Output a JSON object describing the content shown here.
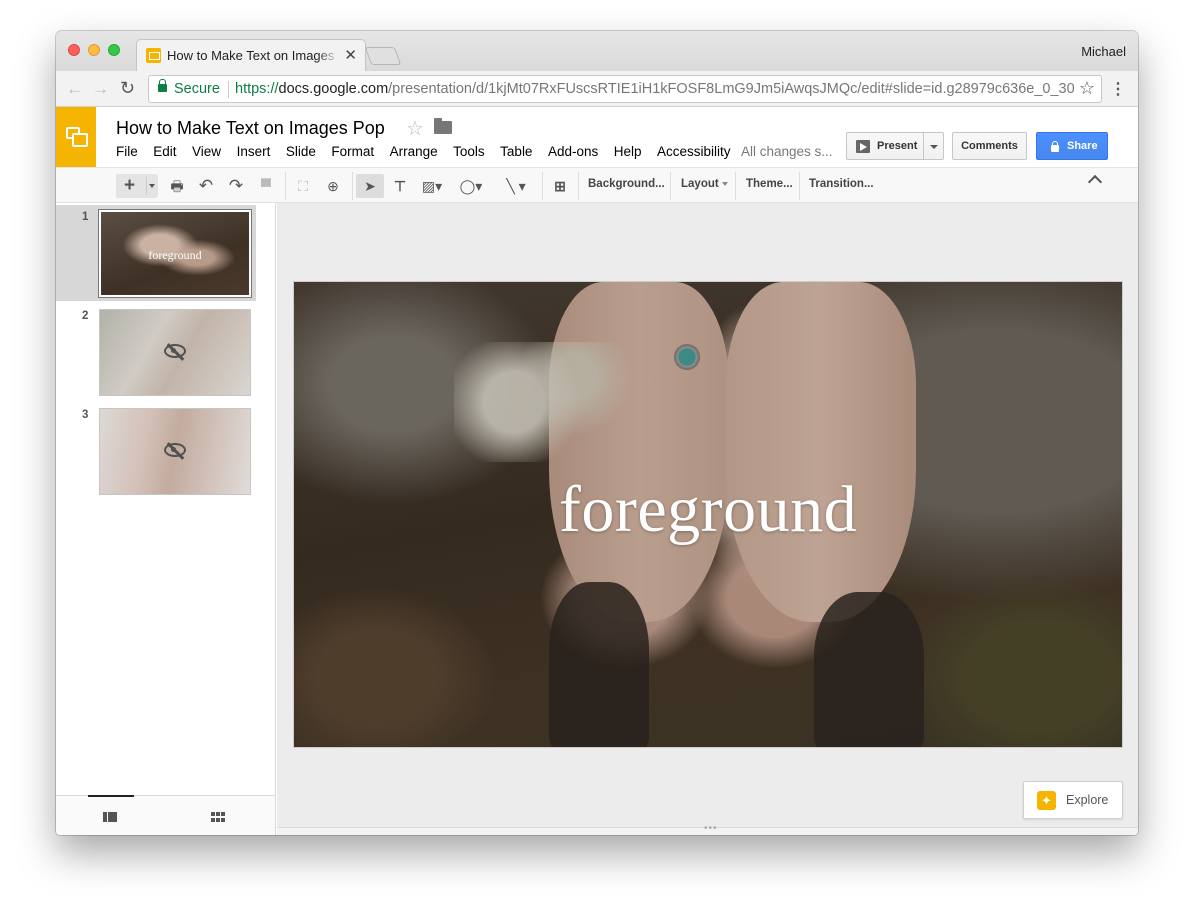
{
  "browser": {
    "tab_title": "How to Make Text on Images Pop",
    "tab_close": "✕",
    "user": "Michael",
    "secure_label": "Secure",
    "url_scheme": "https://",
    "url_host": "docs.google.com",
    "url_path": "/presentation/d/1kjMt07RxFUscsRTIE1iH1kFOSF8LmG9Jm5iAwqsJMQc/edit#slide=id.g28979c636e_0_30"
  },
  "docs": {
    "title": "How to Make Text on Images Pop",
    "menus": [
      "File",
      "Edit",
      "View",
      "Insert",
      "Slide",
      "Format",
      "Arrange",
      "Tools",
      "Table",
      "Add-ons",
      "Help",
      "Accessibility"
    ],
    "save_status": "All changes s...",
    "present_label": "Present",
    "comments_label": "Comments",
    "share_label": "Share"
  },
  "toolbar": {
    "background_label": "Background...",
    "layout_label": "Layout",
    "theme_label": "Theme...",
    "transition_label": "Transition..."
  },
  "filmstrip": {
    "slides": [
      {
        "number": "1",
        "thumb_text": "foreground",
        "hidden": false
      },
      {
        "number": "2",
        "thumb_text": "",
        "hidden": true
      },
      {
        "number": "3",
        "thumb_text": "",
        "hidden": true
      }
    ]
  },
  "slide": {
    "title": "foreground"
  },
  "explore": {
    "label": "Explore"
  },
  "colors": {
    "slides_brand": "#f4b400",
    "share_blue": "#4d90fe",
    "secure_green": "#0b8043"
  }
}
